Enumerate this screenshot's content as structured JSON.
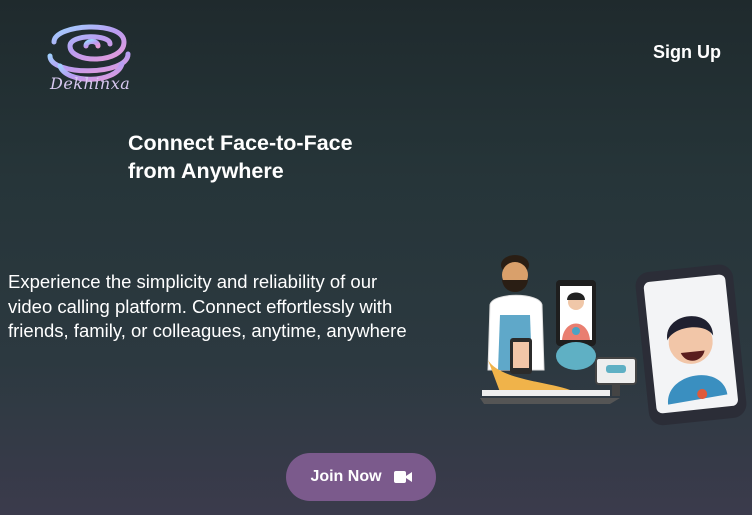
{
  "brand": {
    "name": "Dekhinxa",
    "logo_icon": "spiral-logo-icon"
  },
  "nav": {
    "signup_label": "Sign Up"
  },
  "hero": {
    "headline_line1": "Connect Face-to-Face",
    "headline_line2": "from Anywhere",
    "description": "Experience the simplicity and reliability of our video calling platform. Connect effortlessly with friends, family, or colleagues, anytime, anywhere",
    "cta_label": "Join Now",
    "cta_icon": "video-camera-icon"
  },
  "colors": {
    "background_top": "#1f2a2d",
    "background_bottom": "#3b3b4c",
    "cta_background": "#7b5a8c",
    "text": "#ffffff"
  }
}
